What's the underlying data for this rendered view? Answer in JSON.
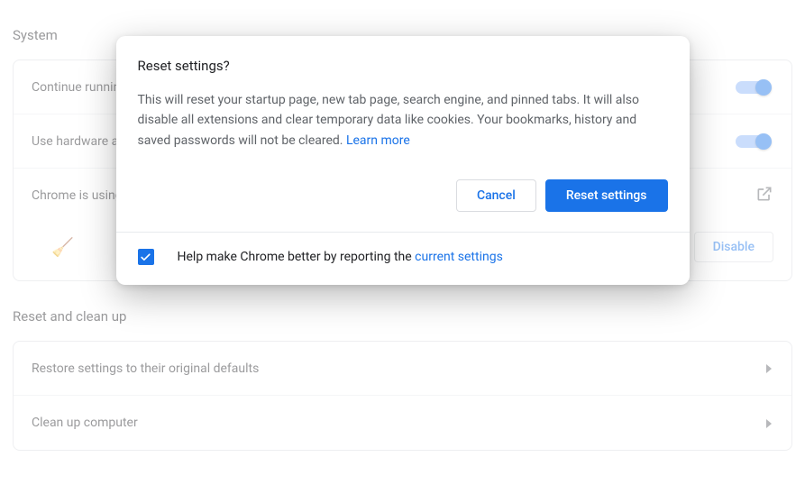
{
  "sections": {
    "system": {
      "title": "System",
      "rows": {
        "continue": "Continue running background apps when Google Chrome is closed",
        "hardware": "Use hardware acceleration when available",
        "chrome_is": "Chrome is using...",
        "disable_label": "Disable"
      }
    },
    "reset": {
      "title": "Reset and clean up",
      "restore": "Restore settings to their original defaults",
      "cleanup": "Clean up computer"
    }
  },
  "dialog": {
    "title": "Reset settings?",
    "body": "This will reset your startup page, new tab page, search engine, and pinned tabs. It will also disable all extensions and clear temporary data like cookies. Your bookmarks, history and saved passwords will not be cleared. ",
    "learn_more": "Learn more",
    "cancel": "Cancel",
    "confirm": "Reset settings",
    "footer_text": "Help make Chrome better by reporting the ",
    "footer_link": "current settings"
  }
}
